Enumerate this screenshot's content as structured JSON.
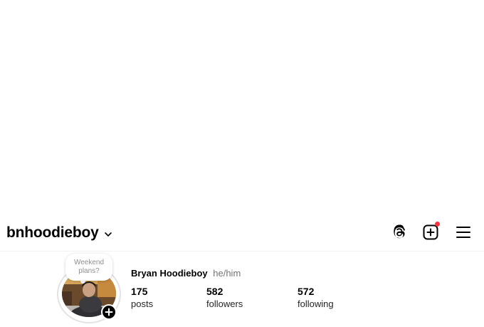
{
  "header": {
    "username": "bnhoodieboy",
    "icons": {
      "account_switcher": "chevron-down-icon",
      "threads": "threads-icon",
      "create": "plus-square-icon",
      "menu": "hamburger-menu-icon"
    },
    "create_has_notification": true,
    "notification_color": "#ff3040"
  },
  "note": {
    "line1": "Weekend",
    "line2": "plans?"
  },
  "profile": {
    "display_name": "Bryan Hoodieboy",
    "pronouns": "he/him",
    "avatar_icon": "profile-photo",
    "add_story_icon": "plus-icon"
  },
  "stats": [
    {
      "value": "175",
      "label": "posts"
    },
    {
      "value": "582",
      "label": "followers"
    },
    {
      "value": "572",
      "label": "following"
    }
  ]
}
